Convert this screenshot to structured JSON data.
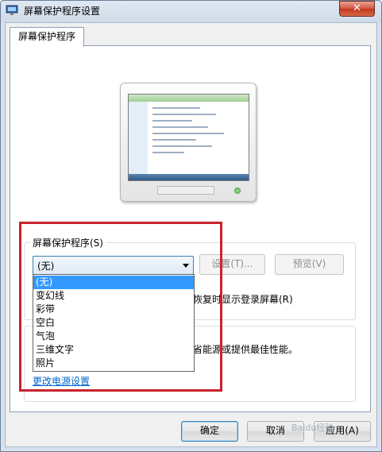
{
  "window": {
    "title": "屏幕保护程序设置",
    "close_label": "✕",
    "tab_label": "屏幕保护程序"
  },
  "screensaver": {
    "group_label": "屏幕保护程序(S)",
    "selected": "(无)",
    "settings_button": "设置(T)...",
    "preview_button": "预览(V)",
    "resume_text": "恢复时显示登录屏幕(R)",
    "options": [
      "(无)",
      "变幻线",
      "彩带",
      "空白",
      "气泡",
      "三维文字",
      "照片"
    ]
  },
  "power": {
    "description": "省能源或提供最佳性能。",
    "link": "更改电源设置"
  },
  "buttons": {
    "ok": "确定",
    "cancel": "取消",
    "apply": "应用(A)"
  },
  "watermark": "Baidu经验",
  "colors": {
    "highlight": "#c9232e",
    "selection": "#3399ff",
    "link": "#0066cc"
  }
}
